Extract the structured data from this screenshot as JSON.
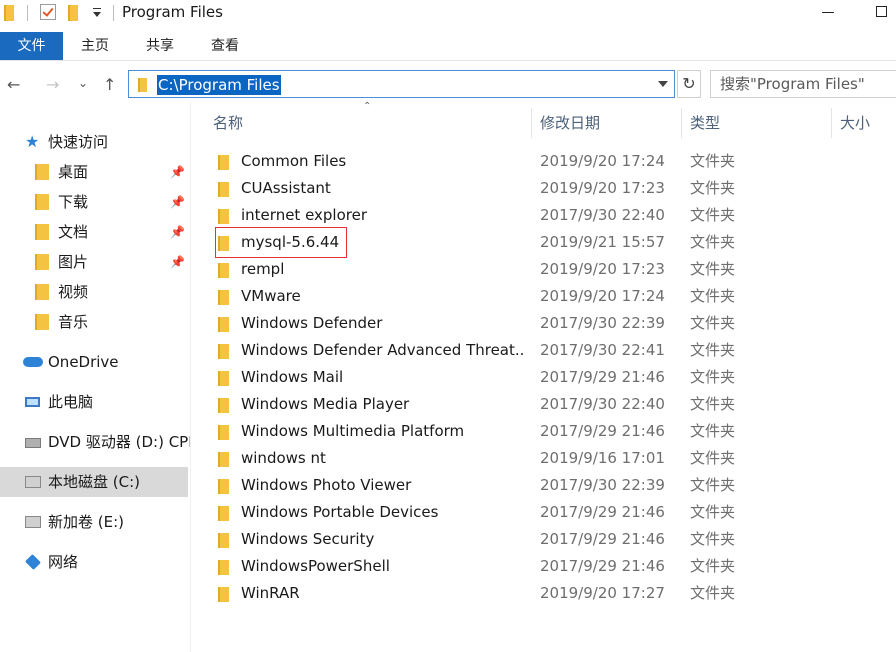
{
  "titlebar": {
    "title": "Program Files"
  },
  "ribbon": {
    "tabs": {
      "file": "文件",
      "home": "主页",
      "share": "共享",
      "view": "查看"
    }
  },
  "nav": {
    "address": "C:\\Program Files",
    "search_placeholder": "搜索\"Program Files\""
  },
  "sidebar": {
    "quick_access": "快速访问",
    "items": [
      {
        "label": "桌面",
        "pinned": true
      },
      {
        "label": "下载",
        "pinned": true
      },
      {
        "label": "文档",
        "pinned": true
      },
      {
        "label": "图片",
        "pinned": true
      },
      {
        "label": "视频",
        "pinned": false
      },
      {
        "label": "音乐",
        "pinned": false
      }
    ],
    "onedrive": "OneDrive",
    "this_pc": "此电脑",
    "dvd": "DVD 驱动器 (D:) CPB",
    "local_disk": "本地磁盘 (C:)",
    "new_volume": "新加卷 (E:)",
    "network": "网络"
  },
  "columns": {
    "name": "名称",
    "modified": "修改日期",
    "type": "类型",
    "size": "大小"
  },
  "files": [
    {
      "name": "Common Files",
      "modified": "2019/9/20 17:24",
      "type": "文件夹"
    },
    {
      "name": "CUAssistant",
      "modified": "2019/9/20 17:23",
      "type": "文件夹"
    },
    {
      "name": "internet explorer",
      "modified": "2017/9/30 22:40",
      "type": "文件夹"
    },
    {
      "name": "mysql-5.6.44",
      "modified": "2019/9/21 15:57",
      "type": "文件夹"
    },
    {
      "name": "rempl",
      "modified": "2019/9/20 17:23",
      "type": "文件夹"
    },
    {
      "name": "VMware",
      "modified": "2019/9/20 17:24",
      "type": "文件夹"
    },
    {
      "name": "Windows Defender",
      "modified": "2017/9/30 22:39",
      "type": "文件夹"
    },
    {
      "name": "Windows Defender Advanced Threat...",
      "modified": "2017/9/30 22:41",
      "type": "文件夹"
    },
    {
      "name": "Windows Mail",
      "modified": "2017/9/29 21:46",
      "type": "文件夹"
    },
    {
      "name": "Windows Media Player",
      "modified": "2017/9/30 22:40",
      "type": "文件夹"
    },
    {
      "name": "Windows Multimedia Platform",
      "modified": "2017/9/29 21:46",
      "type": "文件夹"
    },
    {
      "name": "windows nt",
      "modified": "2019/9/16 17:01",
      "type": "文件夹"
    },
    {
      "name": "Windows Photo Viewer",
      "modified": "2017/9/30 22:39",
      "type": "文件夹"
    },
    {
      "name": "Windows Portable Devices",
      "modified": "2017/9/29 21:46",
      "type": "文件夹"
    },
    {
      "name": "Windows Security",
      "modified": "2017/9/29 21:46",
      "type": "文件夹"
    },
    {
      "name": "WindowsPowerShell",
      "modified": "2017/9/29 21:46",
      "type": "文件夹"
    },
    {
      "name": "WinRAR",
      "modified": "2019/9/20 17:27",
      "type": "文件夹"
    }
  ],
  "colors": {
    "accent": "#1a6ac0",
    "selection": "#0b65c2",
    "highlight_box": "#e53333",
    "folder": "#f5c342"
  }
}
